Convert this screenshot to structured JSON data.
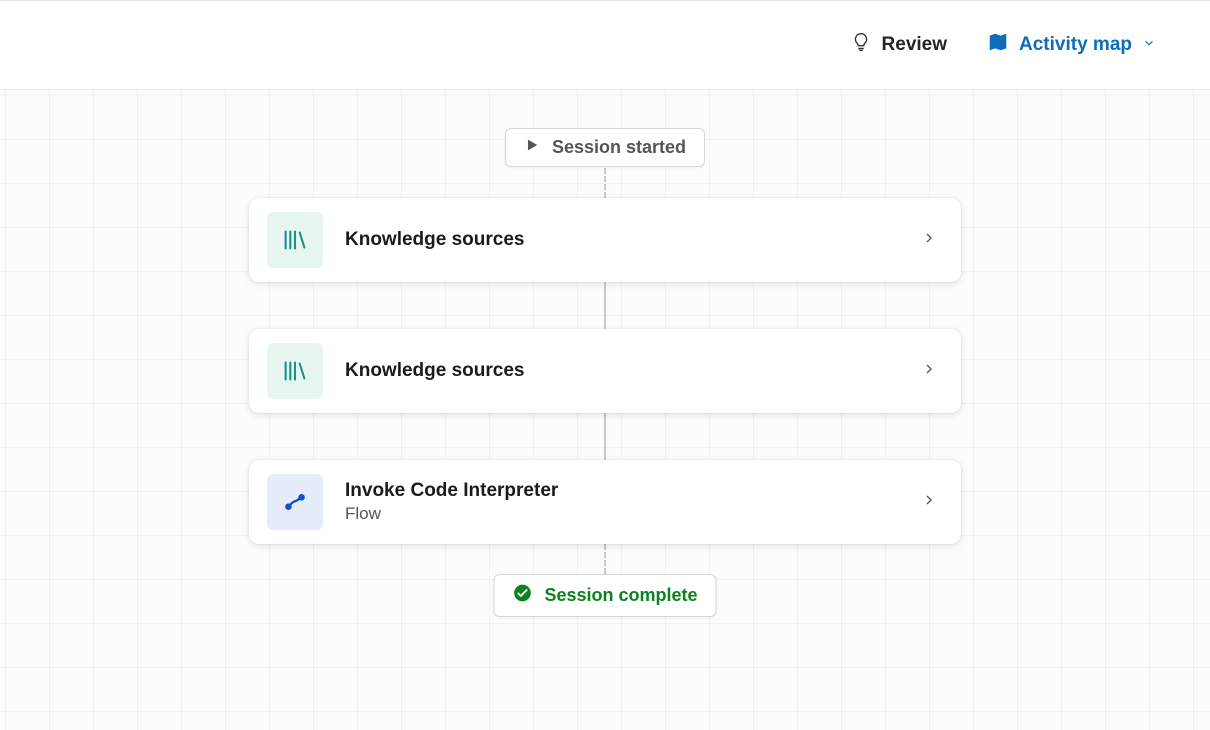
{
  "header": {
    "review_label": "Review",
    "activity_map_label": "Activity map"
  },
  "session": {
    "start_label": "Session started",
    "end_label": "Session complete"
  },
  "cards": [
    {
      "title": "Knowledge sources",
      "subtitle": "",
      "icon": "knowledge"
    },
    {
      "title": "Knowledge sources",
      "subtitle": "",
      "icon": "knowledge"
    },
    {
      "title": "Invoke Code Interpreter",
      "subtitle": "Flow",
      "icon": "flow"
    }
  ],
  "colors": {
    "accent": "#0e6cbd",
    "success": "#0c821f",
    "teal": "#1a9085",
    "blue": "#1250cf"
  }
}
